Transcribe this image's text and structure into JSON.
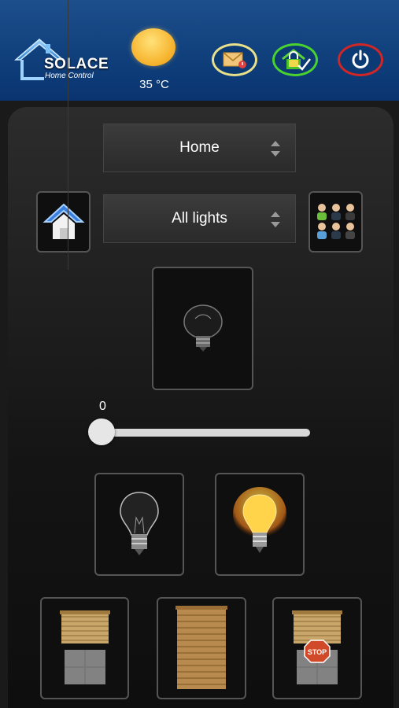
{
  "header": {
    "logo_title": "SOLACE",
    "logo_subtitle": "Home Control",
    "temperature": "35 °C",
    "weather_icon": "sun-icon",
    "buttons": [
      "messages-icon",
      "security-lock-icon",
      "power-icon"
    ],
    "colors": {
      "header_bg": "#0d3c78",
      "messages_ring": "#e8e08a",
      "lock_ring": "#4ad22f",
      "power_ring": "#d12626"
    }
  },
  "controls": {
    "location_select": "Home",
    "group_select": "All lights"
  },
  "slider": {
    "value": "0",
    "level": 0
  },
  "tiles": {
    "current_device": "bulb-off-icon",
    "light_off": "bulb-off-icon",
    "light_on": "bulb-on-icon",
    "blind_open": "blind-open-icon",
    "blind_closed": "blind-closed-icon",
    "blind_stop_label": "STOP"
  }
}
